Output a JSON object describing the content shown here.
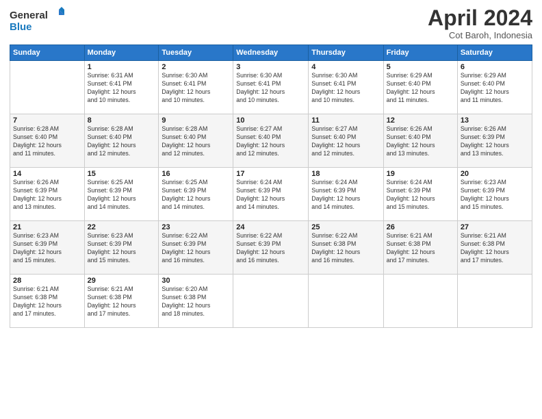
{
  "logo": {
    "line1": "General",
    "line2": "Blue"
  },
  "header": {
    "title": "April 2024",
    "subtitle": "Cot Baroh, Indonesia"
  },
  "days_of_week": [
    "Sunday",
    "Monday",
    "Tuesday",
    "Wednesday",
    "Thursday",
    "Friday",
    "Saturday"
  ],
  "weeks": [
    [
      {
        "day": "",
        "info": ""
      },
      {
        "day": "1",
        "info": "Sunrise: 6:31 AM\nSunset: 6:41 PM\nDaylight: 12 hours\nand 10 minutes."
      },
      {
        "day": "2",
        "info": "Sunrise: 6:30 AM\nSunset: 6:41 PM\nDaylight: 12 hours\nand 10 minutes."
      },
      {
        "day": "3",
        "info": "Sunrise: 6:30 AM\nSunset: 6:41 PM\nDaylight: 12 hours\nand 10 minutes."
      },
      {
        "day": "4",
        "info": "Sunrise: 6:30 AM\nSunset: 6:41 PM\nDaylight: 12 hours\nand 10 minutes."
      },
      {
        "day": "5",
        "info": "Sunrise: 6:29 AM\nSunset: 6:40 PM\nDaylight: 12 hours\nand 11 minutes."
      },
      {
        "day": "6",
        "info": "Sunrise: 6:29 AM\nSunset: 6:40 PM\nDaylight: 12 hours\nand 11 minutes."
      }
    ],
    [
      {
        "day": "7",
        "info": "Sunrise: 6:28 AM\nSunset: 6:40 PM\nDaylight: 12 hours\nand 11 minutes."
      },
      {
        "day": "8",
        "info": "Sunrise: 6:28 AM\nSunset: 6:40 PM\nDaylight: 12 hours\nand 12 minutes."
      },
      {
        "day": "9",
        "info": "Sunrise: 6:28 AM\nSunset: 6:40 PM\nDaylight: 12 hours\nand 12 minutes."
      },
      {
        "day": "10",
        "info": "Sunrise: 6:27 AM\nSunset: 6:40 PM\nDaylight: 12 hours\nand 12 minutes."
      },
      {
        "day": "11",
        "info": "Sunrise: 6:27 AM\nSunset: 6:40 PM\nDaylight: 12 hours\nand 12 minutes."
      },
      {
        "day": "12",
        "info": "Sunrise: 6:26 AM\nSunset: 6:40 PM\nDaylight: 12 hours\nand 13 minutes."
      },
      {
        "day": "13",
        "info": "Sunrise: 6:26 AM\nSunset: 6:39 PM\nDaylight: 12 hours\nand 13 minutes."
      }
    ],
    [
      {
        "day": "14",
        "info": "Sunrise: 6:26 AM\nSunset: 6:39 PM\nDaylight: 12 hours\nand 13 minutes."
      },
      {
        "day": "15",
        "info": "Sunrise: 6:25 AM\nSunset: 6:39 PM\nDaylight: 12 hours\nand 14 minutes."
      },
      {
        "day": "16",
        "info": "Sunrise: 6:25 AM\nSunset: 6:39 PM\nDaylight: 12 hours\nand 14 minutes."
      },
      {
        "day": "17",
        "info": "Sunrise: 6:24 AM\nSunset: 6:39 PM\nDaylight: 12 hours\nand 14 minutes."
      },
      {
        "day": "18",
        "info": "Sunrise: 6:24 AM\nSunset: 6:39 PM\nDaylight: 12 hours\nand 14 minutes."
      },
      {
        "day": "19",
        "info": "Sunrise: 6:24 AM\nSunset: 6:39 PM\nDaylight: 12 hours\nand 15 minutes."
      },
      {
        "day": "20",
        "info": "Sunrise: 6:23 AM\nSunset: 6:39 PM\nDaylight: 12 hours\nand 15 minutes."
      }
    ],
    [
      {
        "day": "21",
        "info": "Sunrise: 6:23 AM\nSunset: 6:39 PM\nDaylight: 12 hours\nand 15 minutes."
      },
      {
        "day": "22",
        "info": "Sunrise: 6:23 AM\nSunset: 6:39 PM\nDaylight: 12 hours\nand 15 minutes."
      },
      {
        "day": "23",
        "info": "Sunrise: 6:22 AM\nSunset: 6:39 PM\nDaylight: 12 hours\nand 16 minutes."
      },
      {
        "day": "24",
        "info": "Sunrise: 6:22 AM\nSunset: 6:39 PM\nDaylight: 12 hours\nand 16 minutes."
      },
      {
        "day": "25",
        "info": "Sunrise: 6:22 AM\nSunset: 6:38 PM\nDaylight: 12 hours\nand 16 minutes."
      },
      {
        "day": "26",
        "info": "Sunrise: 6:21 AM\nSunset: 6:38 PM\nDaylight: 12 hours\nand 17 minutes."
      },
      {
        "day": "27",
        "info": "Sunrise: 6:21 AM\nSunset: 6:38 PM\nDaylight: 12 hours\nand 17 minutes."
      }
    ],
    [
      {
        "day": "28",
        "info": "Sunrise: 6:21 AM\nSunset: 6:38 PM\nDaylight: 12 hours\nand 17 minutes."
      },
      {
        "day": "29",
        "info": "Sunrise: 6:21 AM\nSunset: 6:38 PM\nDaylight: 12 hours\nand 17 minutes."
      },
      {
        "day": "30",
        "info": "Sunrise: 6:20 AM\nSunset: 6:38 PM\nDaylight: 12 hours\nand 18 minutes."
      },
      {
        "day": "",
        "info": ""
      },
      {
        "day": "",
        "info": ""
      },
      {
        "day": "",
        "info": ""
      },
      {
        "day": "",
        "info": ""
      }
    ]
  ]
}
